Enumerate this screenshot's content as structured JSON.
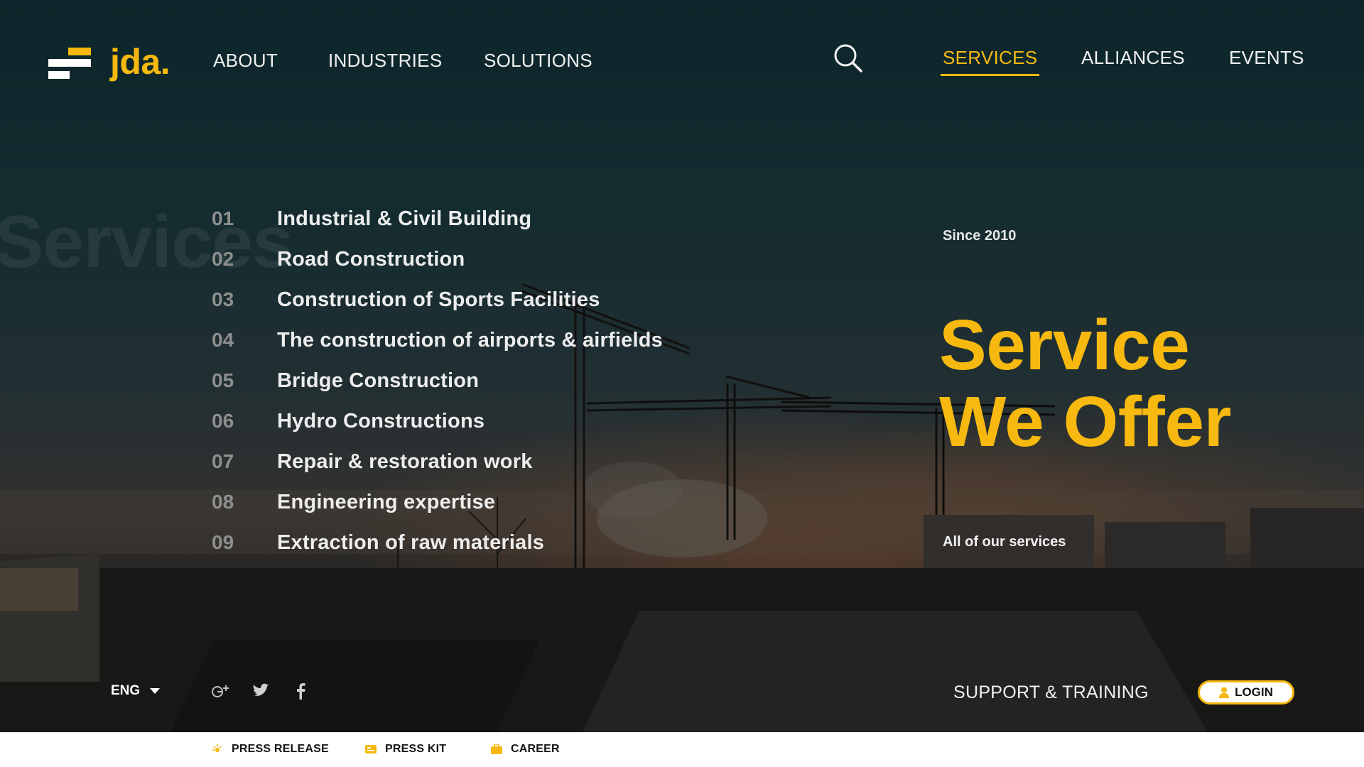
{
  "brand": {
    "name": "jda.",
    "accent": "#f7b90f"
  },
  "nav_left": [
    "ABOUT",
    "INDUSTRIES",
    "SOLUTIONS"
  ],
  "nav_right": [
    "SERVICES",
    "ALLIANCES",
    "EVENTS"
  ],
  "active_nav": "SERVICES",
  "ghost_word": "Services",
  "services": [
    {
      "num": "01",
      "title": "Industrial & Civil Building"
    },
    {
      "num": "02",
      "title": "Road Construction"
    },
    {
      "num": "03",
      "title": "Construction of Sports Facilities"
    },
    {
      "num": "04",
      "title": "The construction of airports & airfields"
    },
    {
      "num": "05",
      "title": "Bridge Construction"
    },
    {
      "num": "06",
      "title": "Hydro Constructions"
    },
    {
      "num": "07",
      "title": "Repair & restoration work"
    },
    {
      "num": "08",
      "title": "Engineering expertise"
    },
    {
      "num": "09",
      "title": "Extraction of raw materials"
    }
  ],
  "since": "Since 2010",
  "headline": {
    "line1": "Service",
    "line2": "We Offer"
  },
  "all_services": "All of our services",
  "footer": {
    "language": "ENG",
    "social_icons": [
      "google-plus-icon",
      "twitter-icon",
      "facebook-icon"
    ],
    "support": "SUPPORT & TRAINING",
    "login": "LOGIN"
  },
  "bottom_links": [
    {
      "label": "PRESS RELEASE",
      "icon": "megaphone-icon"
    },
    {
      "label": "PRESS KIT",
      "icon": "newspaper-icon"
    },
    {
      "label": "CAREER",
      "icon": "briefcase-icon"
    }
  ]
}
